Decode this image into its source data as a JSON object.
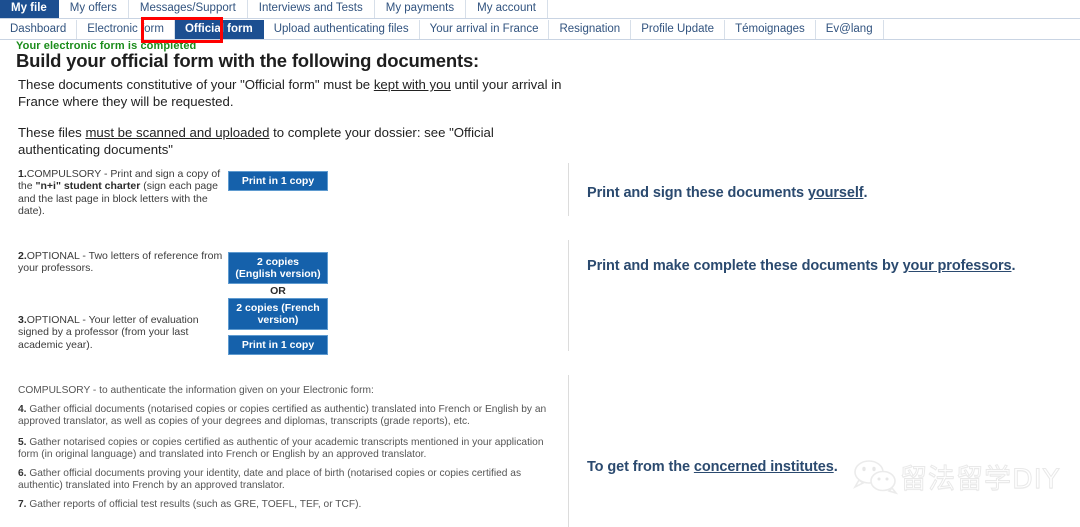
{
  "nav": {
    "primary_tabs": [
      {
        "label": "My file",
        "active": true
      },
      {
        "label": "My offers",
        "active": false
      },
      {
        "label": "Messages/Support",
        "active": false
      },
      {
        "label": "Interviews and Tests",
        "active": false
      },
      {
        "label": "My payments",
        "active": false
      },
      {
        "label": "My account",
        "active": false
      }
    ],
    "secondary_tabs": [
      {
        "label": "Dashboard",
        "active": false
      },
      {
        "label": "Electronic form",
        "active": false
      },
      {
        "label": "Official form",
        "active": true
      },
      {
        "label": "Upload authenticating files",
        "active": false
      },
      {
        "label": "Your arrival in France",
        "active": false
      },
      {
        "label": "Resignation",
        "active": false
      },
      {
        "label": "Profile Update",
        "active": false
      },
      {
        "label": "Témoignages",
        "active": false
      },
      {
        "label": "Ev@lang",
        "active": false
      }
    ],
    "active_tab_highlight_color": "#ff0000",
    "active_tab_background": "#1c4f91"
  },
  "content": {
    "status": "Your electronic form is completed",
    "status_color": "#1a8c1a",
    "title": "Build your official form with the following documents:",
    "intro": {
      "p1_before": "These documents constitutive of your \"Official form\" must be ",
      "p1_underline": "kept with you",
      "p1_after": " until your arrival in France where they will be requested.",
      "p2_before": "These files ",
      "p2_underline": "must be scanned and uploaded",
      "p2_after": " to complete your dossier: see \"Official authenticating documents\""
    }
  },
  "sections": [
    {
      "id": "section-1",
      "items": [
        {
          "number": "1.",
          "kind": "COMPULSORY",
          "text_before": " - Print and sign a copy of the ",
          "bold": "\"n+i\" student charter",
          "text_after": " (sign each page and the last page in block letters with the date)."
        }
      ],
      "buttons": [
        "Print in 1  copy"
      ],
      "callout": {
        "before": "Print and sign these documents ",
        "underline": "yourself",
        "after": "."
      }
    },
    {
      "id": "section-2",
      "items": [
        {
          "number": "2.",
          "kind": "OPTIONAL",
          "text_before": " - Two letters of reference from your professors.",
          "bold": "",
          "text_after": ""
        },
        {
          "number": "3.",
          "kind": "OPTIONAL",
          "text_before": " - Your letter of evaluation signed by a professor (from your last academic year).",
          "bold": "",
          "text_after": ""
        }
      ],
      "buttons": [
        "2 copies (English version)",
        "2 copies (French version)",
        "Print in 1  copy"
      ],
      "or_label": "OR",
      "callout": {
        "before": "Print and make complete these documents by ",
        "underline": "your professors",
        "after": "."
      }
    },
    {
      "id": "section-3",
      "heading": "COMPULSORY - to authenticate the information given on your Electronic form:",
      "paragraphs": [
        {
          "number": "4.",
          "text": " Gather official documents (notarised copies or copies certified as authentic) translated into French or English by an approved translator, as well as copies of your degrees and diplomas, transcripts (grade reports), etc."
        },
        {
          "number": "5.",
          "text": " Gather notarised copies or copies certified as authentic of your academic transcripts mentioned in your application form (in original language) and translated into French or English by an approved translator."
        },
        {
          "number": "6.",
          "text": " Gather official documents proving your identity, date and place of birth (notarised copies or copies certified as authentic) translated into French by an approved translator."
        },
        {
          "number": "7.",
          "text": " Gather reports of official test results (such as GRE, TOEFL, TEF, or TCF)."
        }
      ],
      "callout": {
        "before": "To get from the ",
        "underline": "concerned institutes",
        "after": "."
      }
    }
  ],
  "watermark": {
    "icon": "wechat-icon",
    "text": "留法留学DIY"
  }
}
